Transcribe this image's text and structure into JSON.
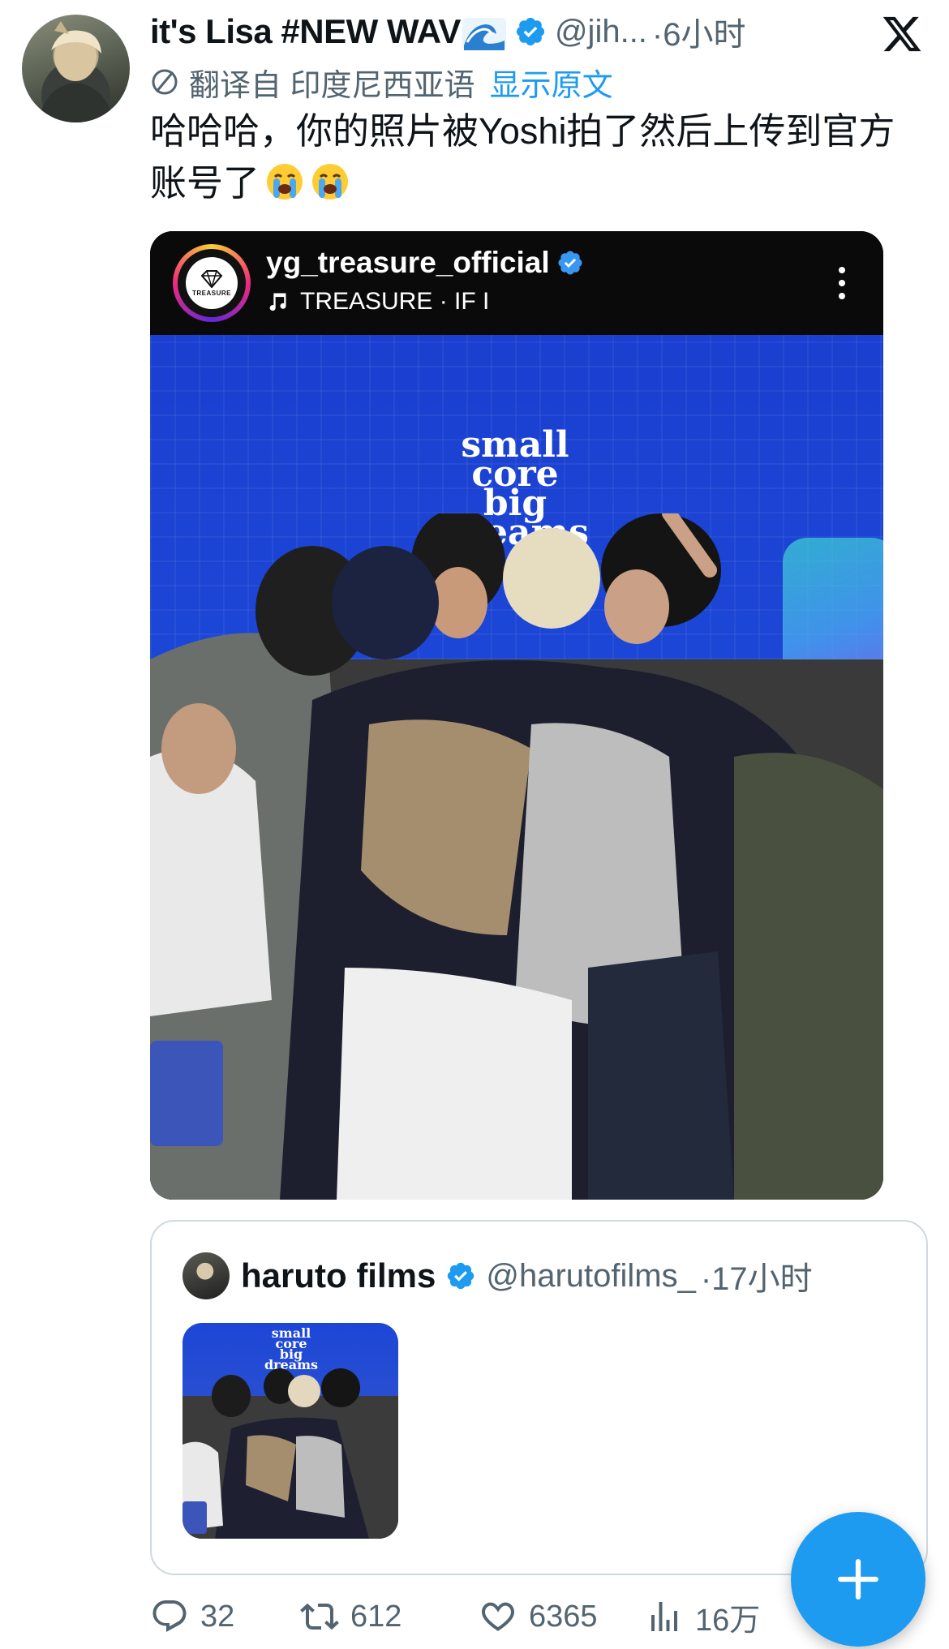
{
  "tweet": {
    "display_name": "it's Lisa #NEW WAV",
    "handle": "@jih...",
    "time": "·6小时",
    "translated_from": "翻译自 印度尼西亚语",
    "show_original": "显示原文",
    "text": "哈哈哈，你的照片被Yoshi拍了然后上传到官方账号了"
  },
  "media": {
    "ig_username": "yg_treasure_official",
    "music": "TREASURE · IF I",
    "logo_text": "TREASURE",
    "slogan": [
      "small",
      "core",
      "big",
      "dreams"
    ]
  },
  "quote": {
    "name": "haruto films",
    "handle": "@harutofilms_",
    "time": "·17小时",
    "slogan": [
      "small",
      "core",
      "big",
      "dreams"
    ]
  },
  "actions": {
    "replies": "32",
    "retweets": "612",
    "likes": "6365",
    "views": "16万"
  },
  "colors": {
    "accent": "#1d9bf0",
    "muted": "#536471"
  },
  "icons": [
    "x-logo-icon",
    "verified-icon",
    "wave-emoji-icon",
    "translate-icon",
    "crying-emoji-icon",
    "music-note-icon",
    "more-vertical-icon",
    "reply-icon",
    "retweet-icon",
    "like-icon",
    "views-icon",
    "plus-icon"
  ]
}
